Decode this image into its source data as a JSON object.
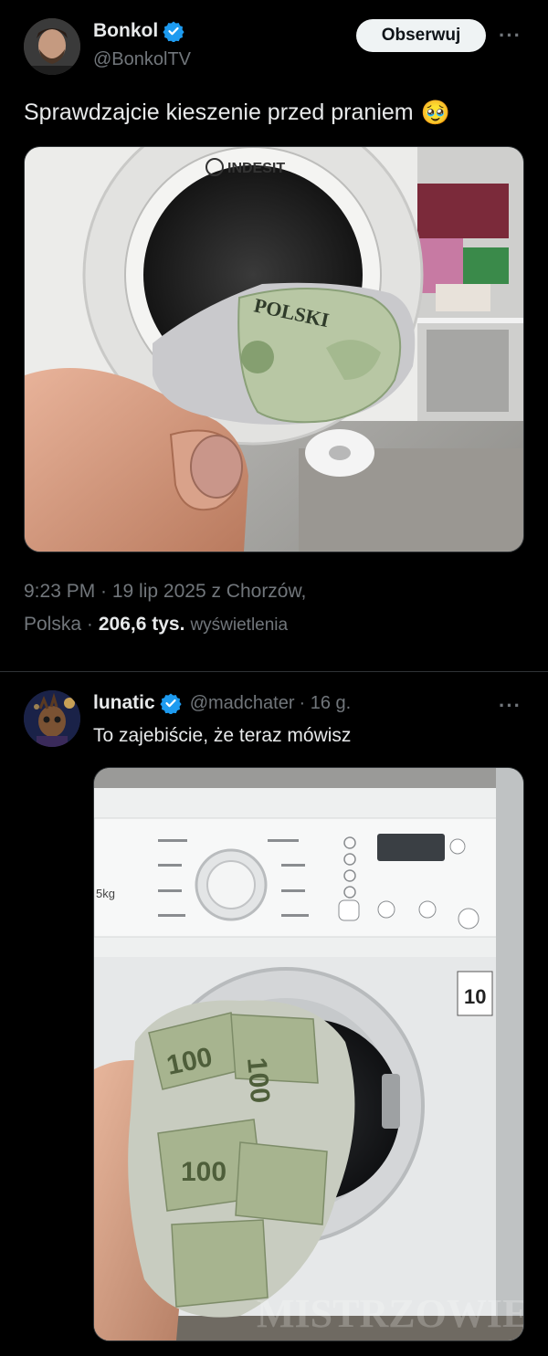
{
  "tweet": {
    "author_name": "Bonkol",
    "author_handle": "@BonkolTV",
    "follow_label": "Obserwuj",
    "more_label": "···",
    "text": "Sprawdzajcie kieszenie przed praniem",
    "emoji": "🥹",
    "time_line1": "9:23 PM · 19 lip 2025 z Chorzów,",
    "location_rest": "Polska ·",
    "views_count": "206,6 tys.",
    "views_label": "wyświetlenia",
    "image_brand": "INDESIT",
    "image_banknote_text": "POLSKI"
  },
  "reply": {
    "author_name": "lunatic",
    "author_handle": "@madchater",
    "time": "· 16 g.",
    "more_label": "···",
    "text": "To zajebiście, że teraz mówisz",
    "image_watermark": "MISTRZOWIE",
    "image_energy_label": "10",
    "image_load_label": "5kg"
  },
  "colors": {
    "background": "#000000",
    "text_primary": "#e7e9ea",
    "text_secondary": "#71767b",
    "verified": "#1d9bf0",
    "button_bg": "#eff3f4"
  },
  "icons": {
    "verified": "verified-badge-icon",
    "more": "more-options-icon"
  }
}
